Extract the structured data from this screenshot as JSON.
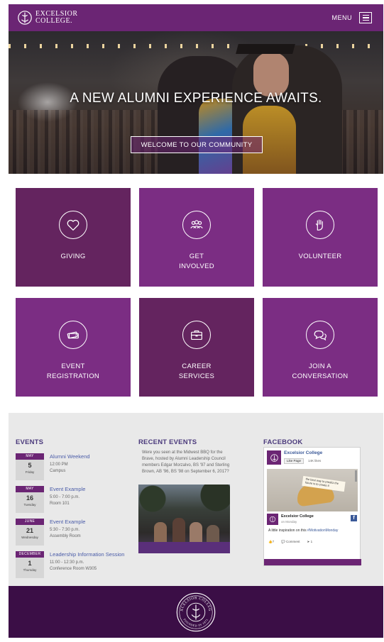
{
  "header": {
    "logo_line1": "EXCELSIOR",
    "logo_line2": "COLLEGE.",
    "menu_label": "MENU",
    "logo_icon": "excelsior-logo-icon",
    "menu_icon": "hamburger-menu-icon"
  },
  "hero": {
    "title": "A NEW ALUMNI EXPERIENCE AWAITS.",
    "button_label": "WELCOME TO OUR COMMUNITY"
  },
  "tiles": [
    {
      "line1": "GIVING",
      "line2": "",
      "icon": "heart-icon",
      "color": "#64245f"
    },
    {
      "line1": "GET",
      "line2": "INVOLVED",
      "icon": "group-icon",
      "color": "#7b2d83"
    },
    {
      "line1": "VOLUNTEER",
      "line2": "",
      "icon": "raised-hand-icon",
      "color": "#7b2d83"
    },
    {
      "line1": "EVENT",
      "line2": "REGISTRATION",
      "icon": "tickets-icon",
      "color": "#7b2d83"
    },
    {
      "line1": "CAREER",
      "line2": "SERVICES",
      "icon": "briefcase-icon",
      "color": "#64245f"
    },
    {
      "line1": "JOIN A",
      "line2": "CONVERSATION",
      "icon": "chat-bubbles-icon",
      "color": "#7b2d83"
    }
  ],
  "events": {
    "heading": "EVENTS",
    "items": [
      {
        "month": "MAY",
        "day": "5",
        "weekday": "Friday",
        "title": "Alumni Weekend",
        "time": "12:00 PM",
        "place": "Campus"
      },
      {
        "month": "MAY",
        "day": "16",
        "weekday": "Tuesday",
        "title": "Event Example",
        "time": "5:00 - 7:00 p.m.",
        "place": "Room 101"
      },
      {
        "month": "JUNE",
        "day": "21",
        "weekday": "Wednesday",
        "title": "Event Example",
        "time": "5:30 - 7:30 p.m.",
        "place": "Assembly Room"
      },
      {
        "month": "DECEMBER",
        "day": "1",
        "weekday": "Thursday",
        "title": "Leadership Information Session",
        "time": "11:00 - 12:30 p.m.",
        "place": "Conference Room W305"
      }
    ]
  },
  "recent": {
    "heading": "RECENT EVENTS",
    "text": "Were you seen at the Midwest BBQ for the Brave, hosted by Alumni Leadership Council members Edgar Morzalvo, BS '97 and Sterling Brown, AB '96, BS '98 on September 6, 2017?"
  },
  "facebook": {
    "heading": "FACEBOOK",
    "page_name": "Excelsior College",
    "like_label": "Like Page",
    "likes": "14K likes",
    "image_text": "the best way to predict the future is to create it",
    "post_name": "Excelsior College",
    "post_time": "on Monday",
    "post_text": "A little inspiration on this",
    "post_tag": "#MotivationMonday",
    "reactions": "7",
    "comment_label": "Comment",
    "shares": "1"
  },
  "footer": {
    "seal_text_top": "EXCELSIOR COLLEGE",
    "seal_text_bottom": "FOUNDED IN 1971"
  },
  "colors": {
    "brand_purple": "#6b2574",
    "footer_purple": "#3b0e46",
    "link_blue": "#4a5ca8"
  }
}
